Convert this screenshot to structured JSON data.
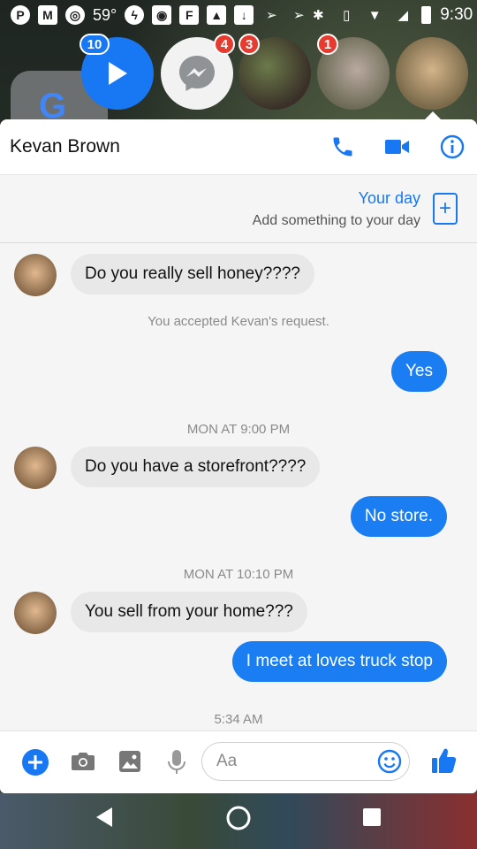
{
  "status_bar": {
    "time": "9:30",
    "temperature": "59°",
    "icons_left": [
      "pinterest-icon",
      "gmail-icon",
      "chrome-icon",
      "temperature",
      "messenger-icon",
      "instagram-icon",
      "flipboard-icon",
      "gallery-icon",
      "download-icon",
      "send-icon",
      "send-icon"
    ],
    "icons_right": [
      "bluetooth-icon",
      "vibrate-icon",
      "wifi-icon",
      "signal-icon",
      "battery-icon"
    ]
  },
  "chat_heads": [
    {
      "type": "play",
      "badge": "10"
    },
    {
      "type": "messenger",
      "badge": "4"
    },
    {
      "type": "photo",
      "badge": "3"
    },
    {
      "type": "photo",
      "badge": "1"
    },
    {
      "type": "photo",
      "badge": ""
    }
  ],
  "header": {
    "contact_name": "Kevan Brown"
  },
  "your_day": {
    "title": "Your day",
    "subtitle": "Add something to your day",
    "add_symbol": "+"
  },
  "messages": [
    {
      "kind": "in",
      "text": "Do you really sell honey????"
    },
    {
      "kind": "system",
      "text": "You accepted Kevan's request."
    },
    {
      "kind": "out",
      "text": "Yes"
    },
    {
      "kind": "timestamp",
      "text": "MON AT 9:00 PM"
    },
    {
      "kind": "in",
      "text": "Do you have a storefront????"
    },
    {
      "kind": "out",
      "text": "No store."
    },
    {
      "kind": "timestamp",
      "text": "MON AT 10:10 PM"
    },
    {
      "kind": "in",
      "text": "You sell from your home???"
    },
    {
      "kind": "out",
      "text": "I meet at loves truck stop"
    },
    {
      "kind": "timestamp",
      "text": "5:34 AM"
    }
  ],
  "composer": {
    "placeholder": "Aa"
  },
  "colors": {
    "accent": "#1877f2",
    "bubble_out": "#1a7ef2",
    "bubble_in": "#e8e8e8",
    "badge": "#e63b2e"
  }
}
